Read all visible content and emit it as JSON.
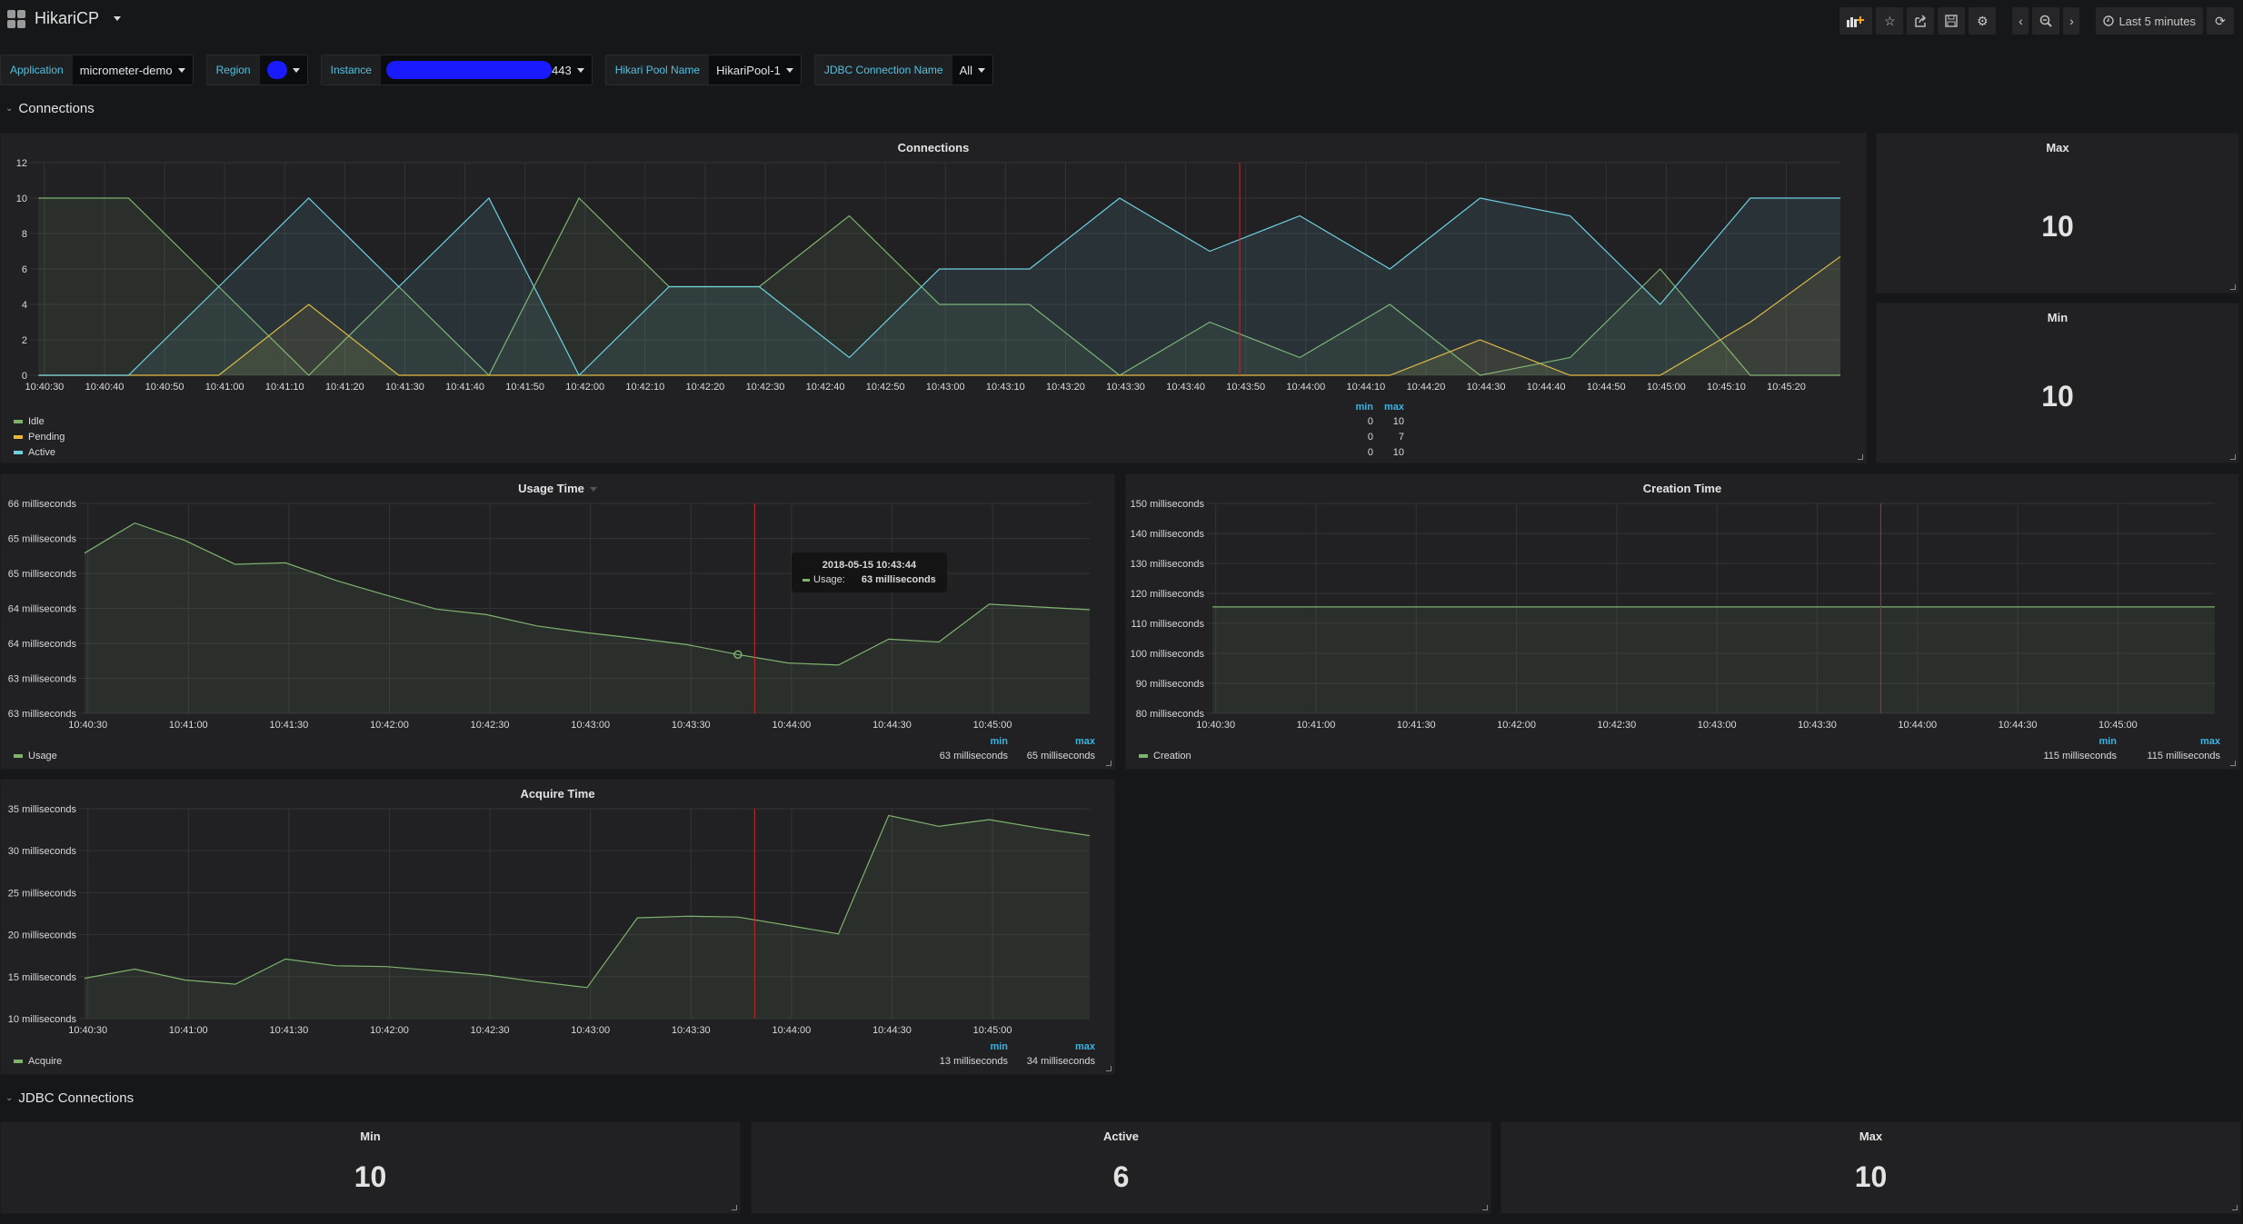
{
  "header": {
    "title": "HikariCP",
    "buttons": {
      "add_panel": "add-panel",
      "star": "star",
      "share": "share",
      "save": "save",
      "settings": "settings",
      "back": "time-back",
      "zoom_out": "zoom-out",
      "forward": "time-forward",
      "refresh": "refresh"
    },
    "time_range": "Last 5 minutes"
  },
  "variables": [
    {
      "label": "Application",
      "value": "micrometer-demo"
    },
    {
      "label": "Region",
      "value": ""
    },
    {
      "label": "Instance",
      "value": "443"
    },
    {
      "label": "Hikari Pool Name",
      "value": "HikariPool-1"
    },
    {
      "label": "JDBC Connection Name",
      "value": "All"
    }
  ],
  "rows": {
    "connections": "Connections",
    "jdbc": "JDBC Connections"
  },
  "colors": {
    "idle": "#7eb26d",
    "pending": "#eab839",
    "active": "#6ed0e0",
    "usage": "#7eb26d",
    "annotation": "#c62828"
  },
  "stats": {
    "max": {
      "title": "Max",
      "value": "10"
    },
    "min": {
      "title": "Min",
      "value": "10"
    },
    "jdbc_min": {
      "title": "Min",
      "value": "10"
    },
    "jdbc_active": {
      "title": "Active",
      "value": "6"
    },
    "jdbc_max": {
      "title": "Max",
      "value": "10"
    }
  },
  "tooltip": {
    "time": "2018-05-15 10:43:44",
    "series": "Usage:",
    "value": "63 milliseconds"
  },
  "chart_data": [
    {
      "type": "area",
      "title": "Connections",
      "x": [
        "10:40:29",
        "10:40:44",
        "10:40:59",
        "10:41:14",
        "10:41:29",
        "10:41:44",
        "10:41:59",
        "10:42:14",
        "10:42:29",
        "10:42:44",
        "10:42:59",
        "10:43:14",
        "10:43:29",
        "10:43:44",
        "10:43:59",
        "10:44:14",
        "10:44:29",
        "10:44:44",
        "10:44:59",
        "10:45:14",
        "10:45:29"
      ],
      "x_ticks": [
        "10:40:30",
        "10:40:40",
        "10:40:50",
        "10:41:00",
        "10:41:10",
        "10:41:20",
        "10:41:30",
        "10:41:40",
        "10:41:50",
        "10:42:00",
        "10:42:10",
        "10:42:20",
        "10:42:30",
        "10:42:40",
        "10:42:50",
        "10:43:00",
        "10:43:10",
        "10:43:20",
        "10:43:30",
        "10:43:40",
        "10:43:50",
        "10:44:00",
        "10:44:10",
        "10:44:20",
        "10:44:30",
        "10:44:40",
        "10:44:50",
        "10:45:00",
        "10:45:10",
        "10:45:20"
      ],
      "y_ticks": [
        "0",
        "2",
        "4",
        "6",
        "8",
        "10",
        "12"
      ],
      "ylim": [
        0,
        12
      ],
      "series": [
        {
          "name": "Idle",
          "values": [
            10,
            10,
            5,
            0,
            5,
            0,
            10,
            5,
            5,
            9,
            4,
            4,
            0,
            3,
            1,
            4,
            0,
            1,
            6,
            0,
            0
          ],
          "min": "0",
          "max": "10"
        },
        {
          "name": "Pending",
          "values": [
            0,
            0,
            0,
            4,
            0,
            0,
            0,
            0,
            0,
            0,
            0,
            0,
            0,
            0,
            0,
            0,
            2,
            0,
            0,
            3,
            6.7
          ],
          "min": "0",
          "max": "7"
        },
        {
          "name": "Active",
          "values": [
            0,
            0,
            5,
            10,
            5,
            10,
            0,
            5,
            5,
            1,
            6,
            6,
            10,
            7,
            9,
            6,
            10,
            9,
            4,
            10,
            10
          ],
          "min": "0",
          "max": "10"
        }
      ],
      "legend_headers": [
        "min",
        "max"
      ],
      "annotation_x": "10:43:49"
    },
    {
      "type": "area",
      "title": "Usage Time",
      "x": [
        "10:40:29",
        "10:40:44",
        "10:40:59",
        "10:41:14",
        "10:41:29",
        "10:41:44",
        "10:41:59",
        "10:42:14",
        "10:42:29",
        "10:42:44",
        "10:42:59",
        "10:43:14",
        "10:43:29",
        "10:43:44",
        "10:43:59",
        "10:44:14",
        "10:44:29",
        "10:44:44",
        "10:44:59",
        "10:45:14",
        "10:45:29"
      ],
      "x_ticks": [
        "10:40:30",
        "10:41:00",
        "10:41:30",
        "10:42:00",
        "10:42:30",
        "10:43:00",
        "10:43:30",
        "10:44:00",
        "10:44:30",
        "10:45:00"
      ],
      "y_ticks": [
        "63 milliseconds",
        "63 milliseconds",
        "64 milliseconds",
        "64 milliseconds",
        "65 milliseconds",
        "65 milliseconds",
        "66 milliseconds"
      ],
      "ylim": [
        62.8,
        65.8
      ],
      "series": [
        {
          "name": "Usage",
          "values": [
            65.09,
            65.52,
            65.27,
            64.93,
            64.95,
            64.7,
            64.49,
            64.29,
            64.21,
            64.05,
            63.95,
            63.87,
            63.78,
            63.64,
            63.52,
            63.49,
            63.86,
            63.82,
            64.36,
            64.32,
            64.28
          ],
          "min": "63 milliseconds",
          "max": "65 milliseconds"
        }
      ],
      "legend_headers": [
        "min",
        "max"
      ],
      "annotation_x": "10:43:49"
    },
    {
      "type": "area",
      "title": "Creation Time",
      "x": [
        "10:40:29",
        "10:45:29"
      ],
      "x_ticks": [
        "10:40:30",
        "10:41:00",
        "10:41:30",
        "10:42:00",
        "10:42:30",
        "10:43:00",
        "10:43:30",
        "10:44:00",
        "10:44:30",
        "10:45:00"
      ],
      "y_ticks": [
        "80 milliseconds",
        "90 milliseconds",
        "100 milliseconds",
        "110 milliseconds",
        "120 milliseconds",
        "130 milliseconds",
        "140 milliseconds",
        "150 milliseconds"
      ],
      "ylim": [
        80,
        150
      ],
      "series": [
        {
          "name": "Creation",
          "values": [
            115.5,
            115.5
          ],
          "min": "115 milliseconds",
          "max": "115 milliseconds"
        }
      ],
      "legend_headers": [
        "min",
        "max"
      ],
      "annotation_x": "10:43:49"
    },
    {
      "type": "area",
      "title": "Acquire Time",
      "x": [
        "10:40:29",
        "10:40:44",
        "10:40:59",
        "10:41:14",
        "10:41:29",
        "10:41:44",
        "10:41:59",
        "10:42:14",
        "10:42:29",
        "10:42:44",
        "10:42:59",
        "10:43:14",
        "10:43:29",
        "10:43:44",
        "10:43:59",
        "10:44:14",
        "10:44:29",
        "10:44:44",
        "10:44:59",
        "10:45:14",
        "10:45:29"
      ],
      "x_ticks": [
        "10:40:30",
        "10:41:00",
        "10:41:30",
        "10:42:00",
        "10:42:30",
        "10:43:00",
        "10:43:30",
        "10:44:00",
        "10:44:30",
        "10:45:00"
      ],
      "y_ticks": [
        "10 milliseconds",
        "15 milliseconds",
        "20 milliseconds",
        "25 milliseconds",
        "30 milliseconds",
        "35 milliseconds"
      ],
      "ylim": [
        10,
        35
      ],
      "series": [
        {
          "name": "Acquire",
          "values": [
            14.8,
            15.9,
            14.6,
            14.1,
            17.1,
            16.3,
            16.2,
            15.7,
            15.2,
            14.4,
            13.7,
            22.0,
            22.2,
            22.1,
            21.1,
            20.1,
            34.2,
            32.9,
            33.7,
            32.7,
            31.8
          ],
          "min": "13 milliseconds",
          "max": "34 milliseconds"
        }
      ],
      "legend_headers": [
        "min",
        "max"
      ],
      "annotation_x": "10:43:49"
    }
  ]
}
